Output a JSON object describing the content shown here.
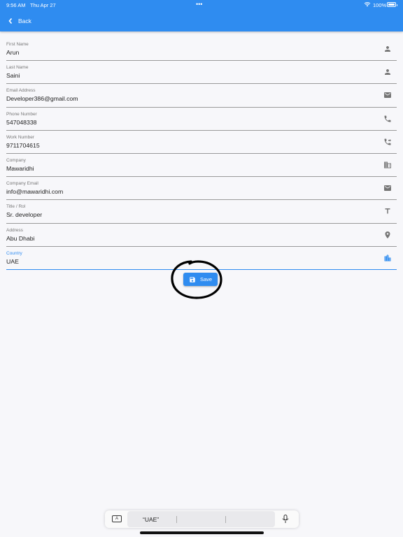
{
  "status_bar": {
    "time": "9:56 AM",
    "date": "Thu Apr 27",
    "dots": "•••",
    "battery": "100%"
  },
  "header": {
    "back_label": "Back",
    "background": "#2f8cf0"
  },
  "form": {
    "fields": [
      {
        "label": "First Name",
        "value": "Arun",
        "icon": "person-icon"
      },
      {
        "label": "Last Name",
        "value": "Saini",
        "icon": "person-icon"
      },
      {
        "label": "Email Address",
        "value": "Developer386@gmail.com",
        "icon": "mail-icon"
      },
      {
        "label": "Phone Number",
        "value": "547048338",
        "icon": "phone-icon"
      },
      {
        "label": "Work Number",
        "value": "9711704615",
        "icon": "phone-forward-icon"
      },
      {
        "label": "Company",
        "value": "Mawaridhi",
        "icon": "business-icon"
      },
      {
        "label": "Company Email",
        "value": "info@mawaridhi.com",
        "icon": "mail-icon"
      },
      {
        "label": "Title / Rol",
        "value": "Sr. developer",
        "icon": "title-icon"
      },
      {
        "label": "Address",
        "value": "Abu Dhabi",
        "icon": "location-pin-icon"
      },
      {
        "label": "Country",
        "value": "UAE",
        "icon": "city-icon",
        "focused": true
      }
    ]
  },
  "save_button": {
    "label": "Save"
  },
  "keyboard_bar": {
    "key_label": "A",
    "suggestions": [
      "“UAE”",
      "",
      ""
    ]
  },
  "colors": {
    "accent": "#2f8cf0",
    "icon_gray": "#757575",
    "annotation": "#000000"
  }
}
